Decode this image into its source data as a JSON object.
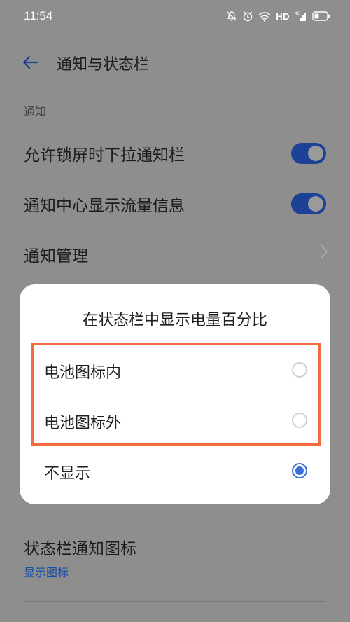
{
  "status_bar": {
    "time": "11:54",
    "hd_label": "HD",
    "icons": [
      "mute-bell-icon",
      "alarm-icon",
      "wifi-icon",
      "cellular-signal-icon",
      "battery-icon"
    ]
  },
  "header": {
    "title": "通知与状态栏",
    "back_icon": "arrow-left-icon"
  },
  "section": {
    "label": "通知"
  },
  "rows": [
    {
      "label": "允许锁屏时下拉通知栏",
      "control": "toggle",
      "on": true
    },
    {
      "label": "通知中心显示流量信息",
      "control": "toggle",
      "on": true
    },
    {
      "label": "通知管理",
      "control": "chevron"
    }
  ],
  "status_icon_row": {
    "label": "状态栏通知图标",
    "value": "显示图标"
  },
  "dialog": {
    "title": "在状态栏中显示电量百分比",
    "options": [
      {
        "label": "电池图标内",
        "selected": false
      },
      {
        "label": "电池图标外",
        "selected": false
      },
      {
        "label": "不显示",
        "selected": true
      }
    ]
  },
  "colors": {
    "accent": "#1c4196",
    "radio_selected": "#3a6fd8",
    "highlight_border": "#f26b3a",
    "link_text": "#1a4da8",
    "scrim": "#8e8e8e"
  }
}
